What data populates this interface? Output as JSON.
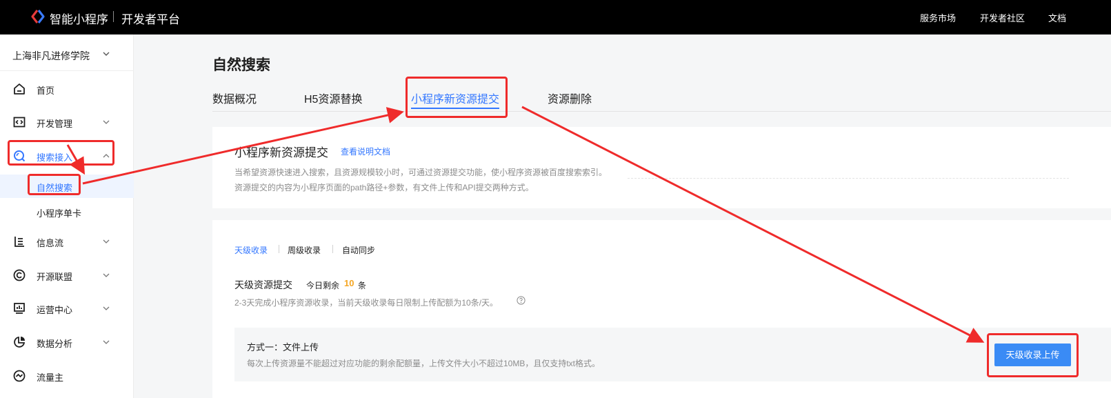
{
  "header": {
    "brand": "智能小程序",
    "platform": "开发者平台",
    "links": [
      "服务市场",
      "开发者社区",
      "文档"
    ]
  },
  "sidebar": {
    "org": "上海非凡进修学院",
    "items": [
      {
        "label": "首页",
        "icon": "home-icon"
      },
      {
        "label": "开发管理",
        "icon": "code-icon"
      },
      {
        "label": "搜索接入",
        "icon": "search-icon"
      },
      {
        "label": "自然搜索"
      },
      {
        "label": "小程序单卡"
      },
      {
        "label": "信息流",
        "icon": "feed-icon"
      },
      {
        "label": "开源联盟",
        "icon": "alliance-icon"
      },
      {
        "label": "运营中心",
        "icon": "operations-icon"
      },
      {
        "label": "数据分析",
        "icon": "data-analysis-icon"
      },
      {
        "label": "流量主",
        "icon": "traffic-icon"
      }
    ]
  },
  "main": {
    "title": "自然搜索",
    "tabs": [
      "数据概况",
      "H5资源替换",
      "小程序新资源提交",
      "资源删除"
    ],
    "intro": {
      "title": "小程序新资源提交",
      "doc_link": "查看说明文档",
      "desc1": "当希望资源快速进入搜索，且资源规模较小时，可通过资源提交功能，使小程序资源被百度搜索索引。",
      "desc2": "资源提交的内容为小程序页面的path路径+参数，有文件上传和API提交两种方式。"
    },
    "subtabs": [
      "天级收录",
      "周级收录",
      "自动同步"
    ],
    "daily": {
      "title": "天级资源提交",
      "remain_prefix": "今日剩余",
      "remain_count": "10",
      "remain_unit": "条",
      "rule": "2-3天完成小程序资源收录，当前天级收录每日限制上传配额为10条/天。"
    },
    "method": {
      "title": "方式一：文件上传",
      "desc": "每次上传资源量不能超过对应功能的剩余配额量，上传文件大小不超过10MB，且仅支持txt格式。",
      "button": "天级收录上传"
    }
  },
  "colors": {
    "accent": "#3377ff",
    "annotation": "#ef2b2b",
    "count_highlight": "#f5a623"
  }
}
